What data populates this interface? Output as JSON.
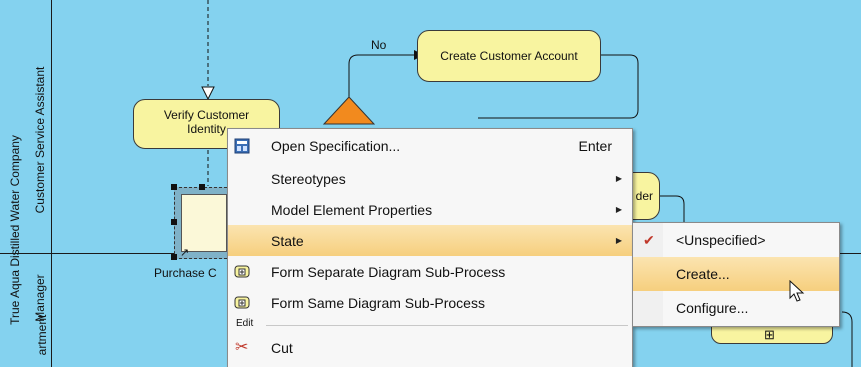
{
  "pool": {
    "label": "True Aqua Distilled Water Company"
  },
  "lanes": [
    {
      "label": "Customer Service Assistant"
    },
    {
      "label": "Manager"
    },
    {
      "label": "artment"
    }
  ],
  "diagram": {
    "no_label": "No",
    "task_create_account": "Create Customer Account",
    "task_verify": "Verify Customer Identity",
    "task_partial_right": "der",
    "task_purchase_partial": "Purchase C",
    "plus_glyph": "⊞"
  },
  "context_menu": {
    "items": [
      {
        "label": "Open Specification...",
        "accel": "Enter",
        "icon": "specification-icon"
      },
      {
        "label": "Stereotypes",
        "submenu": true
      },
      {
        "label": "Model Element Properties",
        "submenu": true
      },
      {
        "label": "State",
        "submenu": true,
        "highlighted": true
      },
      {
        "label": "Form Separate Diagram Sub-Process",
        "icon": "subprocess-icon"
      },
      {
        "label": "Form Same Diagram Sub-Process",
        "icon": "subprocess-icon"
      }
    ],
    "section_edit": "Edit",
    "cut_label": "Cut"
  },
  "state_submenu": {
    "items": [
      {
        "label": "<Unspecified>",
        "checked": true
      },
      {
        "label": "Create...",
        "highlighted": true
      },
      {
        "label": "Configure..."
      }
    ]
  },
  "colors": {
    "canvas": "#84d2ef",
    "task_fill": "#f8f4a0",
    "gateway": "#f28a1e",
    "menu_highlight": "#f6cf7e"
  }
}
